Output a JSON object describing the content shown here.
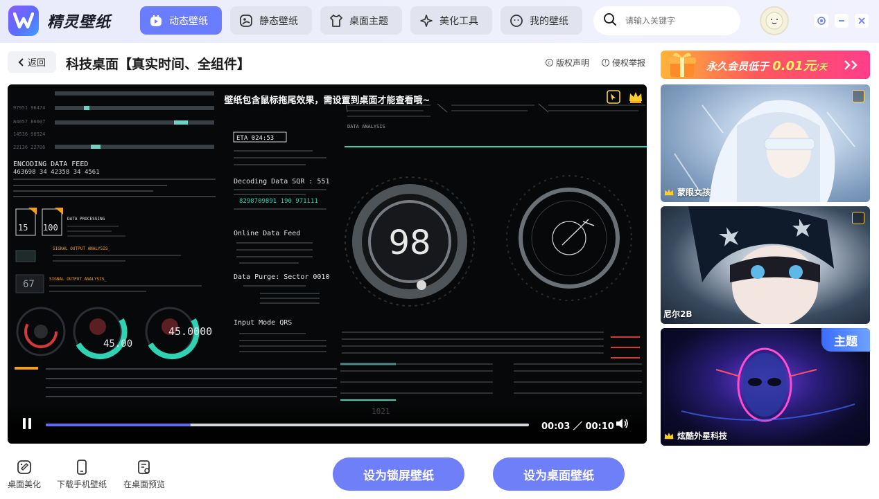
{
  "app": {
    "name": "精灵壁纸"
  },
  "nav": {
    "tabs": [
      {
        "label": "动态壁纸",
        "icon": "play-icon",
        "active": true
      },
      {
        "label": "静态壁纸",
        "icon": "image-icon",
        "active": false
      },
      {
        "label": "桌面主题",
        "icon": "shirt-icon",
        "active": false
      },
      {
        "label": "美化工具",
        "icon": "sparkle-icon",
        "active": false
      },
      {
        "label": "我的壁纸",
        "icon": "smile-icon",
        "active": false
      }
    ]
  },
  "search": {
    "placeholder": "请输入关键字"
  },
  "window_controls": [
    "settings-icon",
    "minimize-icon",
    "close-icon"
  ],
  "header": {
    "back_label": "返回",
    "title": "科技桌面【真实时间、全组件】",
    "copyright_label": "版权声明",
    "report_label": "侵权举报"
  },
  "player": {
    "notice": "壁纸包含鼠标拖尾效果，需设置到桌面才能查看哦~",
    "current_time": "00:03",
    "duration": "00:10",
    "time_sep": "／",
    "progress": 0.3,
    "hud": {
      "big_number": "98",
      "feed_title": "ENCODING DATA FEED",
      "feed_numbers": "463698   34  42358   34   4561",
      "eta": "ETA  024:53",
      "decoding": "Decoding Data SQR : 551",
      "decoding_nums": "8298709891  190  971111",
      "online": "Online Data Feed",
      "purge": "Data Purge: Sector 0010",
      "input_mode": "Input Mode QRS",
      "data_analysis": "DATA ANALYSIS",
      "data_processing": "DATA PROCESSING",
      "signal1": "SIGNAL OUTPUT ANALYSIS_",
      "signal2": "SIGNAL OUTPUT ANALYSIS_",
      "gauge_a": "67",
      "box_a": "15",
      "box_b": "100",
      "gauge_b": "45.00",
      "gauge_c": "45.0000",
      "bottom_num": "1021"
    }
  },
  "tools": [
    {
      "label": "桌面美化",
      "icon": "palette-icon"
    },
    {
      "label": "下载手机壁纸",
      "icon": "phone-icon"
    },
    {
      "label": "在桌面预览",
      "icon": "preview-icon"
    }
  ],
  "actions": {
    "lock_screen": "设为锁屏壁纸",
    "desktop": "设为桌面壁纸"
  },
  "sidebar": {
    "vip_text": "永久会员低于",
    "vip_price": "0.01元",
    "vip_unit": "/天",
    "cards": [
      {
        "label": "蒙眼女孩",
        "crown": true,
        "badge": true
      },
      {
        "label": "尼尔2B",
        "crown": false,
        "badge": true
      },
      {
        "label": "炫酷外星科技",
        "crown": true,
        "theme": "主题"
      }
    ]
  },
  "colors": {
    "accent": "#6b7dff",
    "button": "#6f7ff7",
    "progress": "#5f6cf0",
    "hud_teal": "#2fd3b3",
    "hud_red": "#d23a3a",
    "hud_orange": "#f0a020"
  }
}
